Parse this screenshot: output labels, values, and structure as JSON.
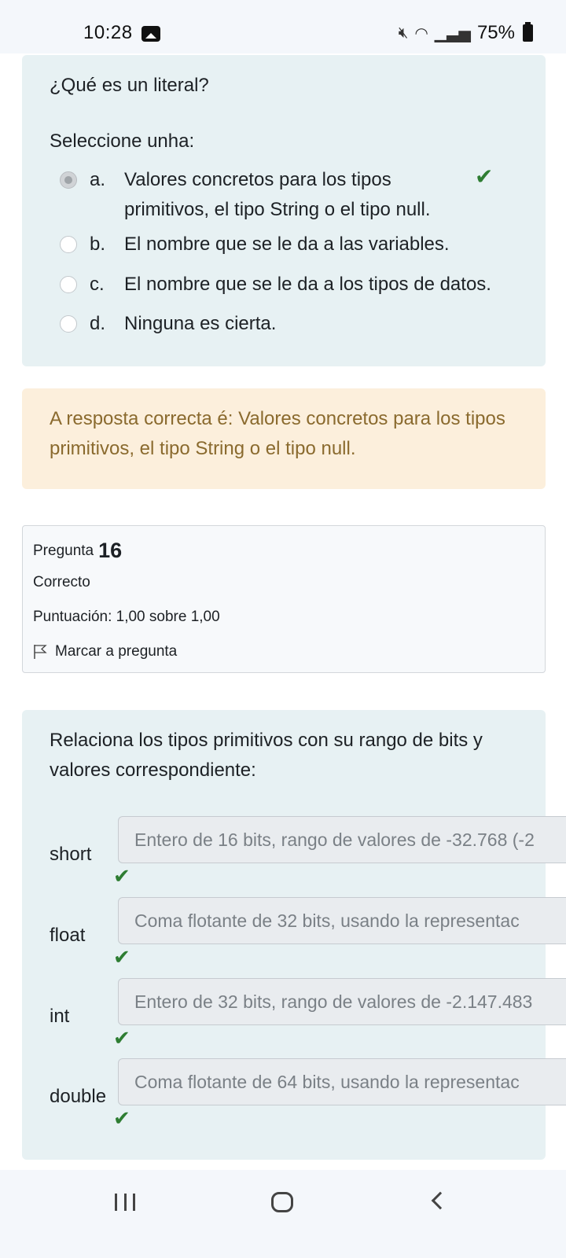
{
  "status_bar": {
    "time": "10:28",
    "battery": "75%",
    "icons": [
      "gallery-icon",
      "mute-icon",
      "wifi-icon",
      "signal-icon",
      "battery-icon"
    ]
  },
  "question1": {
    "text": "¿Qué es un literal?",
    "select_label": "Seleccione unha:",
    "options": [
      {
        "letter": "a.",
        "text": "Valores concretos para los tipos primitivos, el tipo String o el tipo null.",
        "selected": true,
        "correct": true
      },
      {
        "letter": "b.",
        "text": "El nombre que se le da a las variables.",
        "selected": false
      },
      {
        "letter": "c.",
        "text": "El nombre que se le da a los tipos de datos.",
        "selected": false
      },
      {
        "letter": "d.",
        "text": "Ninguna es cierta.",
        "selected": false
      }
    ]
  },
  "feedback": {
    "text": "A resposta correcta é: Valores concretos para los tipos primitivos, el tipo String o el tipo null."
  },
  "info": {
    "question_label": "Pregunta",
    "question_number": "16",
    "status": "Correcto",
    "score": "Puntuación: 1,00 sobre 1,00",
    "flag_label": "Marcar a pregunta"
  },
  "question2": {
    "text": "Relaciona los tipos primitivos con su rango de bits y valores correspondiente:",
    "matches": [
      {
        "label": "short",
        "value": "Entero de 16 bits, rango de valores de -32.768 (-2"
      },
      {
        "label": "float",
        "value": "Coma flotante de 32 bits, usando la representac"
      },
      {
        "label": "int",
        "value": "Entero de 32 bits, rango de valores de -2.147.483"
      },
      {
        "label": "double",
        "value": "Coma flotante de 64 bits, usando la representac"
      }
    ]
  },
  "colors": {
    "question_bg": "#e7f1f3",
    "feedback_bg": "#fcefdc",
    "feedback_text": "#8a6a2e",
    "check": "#2e7d32"
  }
}
